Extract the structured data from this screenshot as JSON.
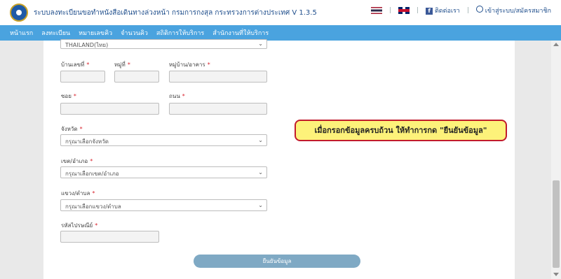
{
  "header": {
    "title": "ระบบลงทะเบียนขอทำหนังสือเดินทางล่วงหน้า กรมการกงสุล กระทรวงการต่างประเทศ V 1.3.5",
    "contact_label": "ติดต่อเรา",
    "login_label": "เข้าสู่ระบบ/สมัครสมาชิก",
    "separator": "|",
    "fb_glyph": "f"
  },
  "nav": {
    "items": [
      "หน้าแรก",
      "ลงทะเบียน",
      "หมายเลขคิว",
      "จำนวนคิว",
      "สถิติการให้บริการ",
      "สำนักงานที่ให้บริการ"
    ]
  },
  "form": {
    "country_value": "THAILAND(ไทย)",
    "house_no_label": "บ้านเลขที่",
    "moo_label": "หมู่ที่",
    "village_label": "หมู่บ้าน/อาคาร",
    "soi_label": "ซอย",
    "road_label": "ถนน",
    "province_label": "จังหวัด",
    "province_placeholder": "กรุณาเลือกจังหวัด",
    "district_label": "เขต/อำเภอ",
    "district_placeholder": "กรุณาเลือกเขต/อำเภอ",
    "subdistrict_label": "แขวง/ตำบล",
    "subdistrict_placeholder": "กรุณาเลือกแขวง/ตำบล",
    "postcode_label": "รหัสไปรษณีย์",
    "required_mark": "*",
    "chevron": "⌄"
  },
  "submit_label": "ยืนยันข้อมูล",
  "callout_text": "เมื่อกรอกข้อมูลครบถ้วน ให้ทำการกด \"ยืนยันข้อมูล\"",
  "colors": {
    "navbar": "#4aa3df",
    "title_text": "#1f4e8c",
    "callout_bg": "#fdf27a",
    "callout_border": "#c21b2c",
    "submit_button": "#7fa9c4",
    "required": "#d9232d"
  }
}
